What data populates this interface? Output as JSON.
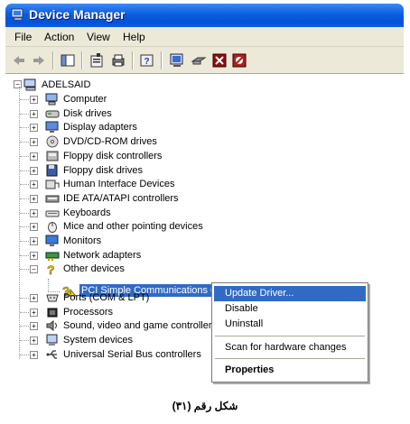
{
  "window": {
    "title": "Device Manager"
  },
  "menu": [
    "File",
    "Action",
    "View",
    "Help"
  ],
  "tree": {
    "root": "ADELSAID",
    "categories": [
      "Computer",
      "Disk drives",
      "Display adapters",
      "DVD/CD-ROM drives",
      "Floppy disk controllers",
      "Floppy disk drives",
      "Human Interface Devices",
      "IDE ATA/ATAPI controllers",
      "Keyboards",
      "Mice and other pointing devices",
      "Monitors",
      "Network adapters",
      "Other devices"
    ],
    "other_child": "PCI Simple Communications Controller",
    "categories_after": [
      "Ports (COM & LPT)",
      "Processors",
      "Sound, video and game controllers",
      "System devices",
      "Universal Serial Bus controllers"
    ]
  },
  "context_menu": {
    "items": [
      "Update Driver...",
      "Disable",
      "Uninstall",
      "Scan for hardware changes",
      "Properties"
    ]
  },
  "caption": "شكل رقم (٣١)"
}
